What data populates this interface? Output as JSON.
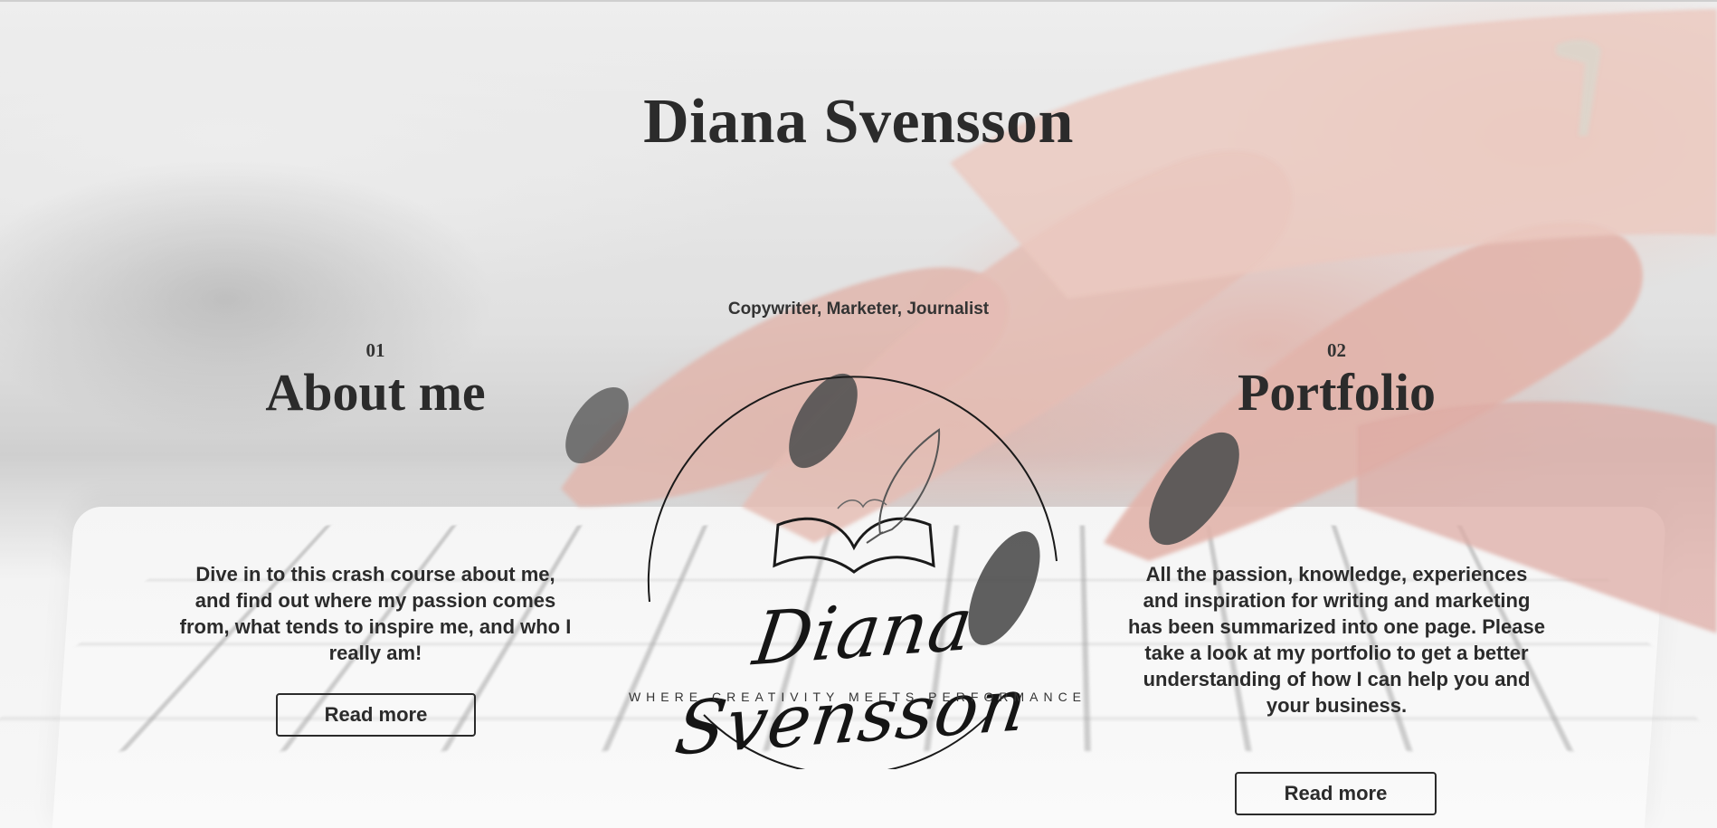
{
  "site": {
    "title": "Diana Svensson",
    "tagline": "Copywriter, Marketer, Journalist"
  },
  "logo": {
    "signature": "Diana Svensson",
    "subtitle": "WHERE CREATIVITY MEETS PERFORMANCE"
  },
  "sections": [
    {
      "number": "01",
      "title": "About me",
      "description": "Dive in to this crash course about me, and find out where my passion comes from, what tends to inspire me, and who I really am!",
      "button_label": "Read more"
    },
    {
      "number": "02",
      "title": "Portfolio",
      "description": "All the passion, knowledge, experiences and inspiration for writing and marketing has been summarized into one page. Please take a look at my portfolio to get a better understanding of how I can help you and your business.",
      "button_label": "Read more"
    }
  ],
  "colors": {
    "text": "#2b2b2b",
    "nail_polish": "#3a3a3a",
    "skin": "#e3b2a8"
  }
}
